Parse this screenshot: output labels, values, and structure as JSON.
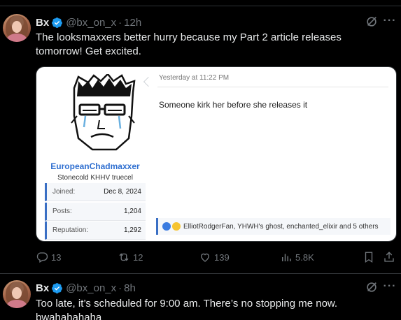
{
  "tweet1": {
    "name": "Bx",
    "handle": "@bx_on_x",
    "separator": "·",
    "time": "12h",
    "text_line1": "The looksmaxxers better hurry because my Part 2 article releases",
    "text_line2": "tomorrow! Get excited.",
    "media": {
      "username": "EuropeanChadmaxxer",
      "user_title": "Stonecold KHHV truecel",
      "stats": [
        {
          "label": "Joined:",
          "value": "Dec 8, 2024"
        },
        {
          "label": "Posts:",
          "value": "1,204"
        },
        {
          "label": "Reputation:",
          "value": "1,292"
        }
      ],
      "post_time": "Yesterday at 11:22 PM",
      "post_body": "Someone kirk her before she releases it",
      "reactions_text": "ElliotRodgerFan, YHWH's ghost, enchanted_elixir and 5 others"
    },
    "actions": {
      "replies": "13",
      "reposts": "12",
      "likes": "139",
      "views": "5.8K"
    }
  },
  "tweet2": {
    "name": "Bx",
    "handle": "@bx_on_x",
    "separator": "·",
    "time": "8h",
    "text_line1": "Too late, it’s scheduled for 9:00 am. There’s no stopping me now.",
    "text_line2": "bwahahahaha"
  },
  "colors": {
    "background": "#000000",
    "text": "#e7e9ea",
    "muted": "#71767b",
    "verified": "#1d9bf0",
    "forum_link": "#2f6fd0"
  }
}
